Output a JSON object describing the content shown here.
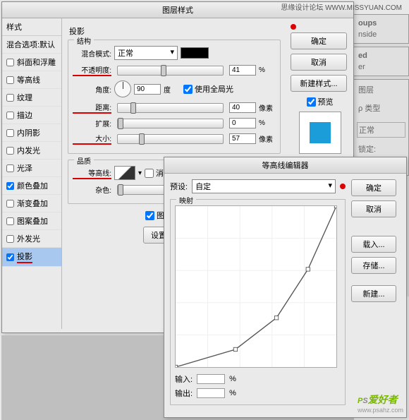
{
  "watermark_top": "思缘设计论坛  WWW.MISSYUAN.COM",
  "watermark_bottom": {
    "p": "P",
    "s": "S",
    "cn": "爱好者",
    "url": "www.psahz.com"
  },
  "bg": {
    "oups": "oups",
    "nside": "nside",
    "ed": "ed",
    "er": "er",
    "layers": "图层",
    "normal": "正常",
    "lock": "锁定:"
  },
  "layer_style": {
    "title": "图层样式",
    "left_header": "样式",
    "blend_default": "混合选项:默认",
    "items": [
      {
        "label": "斜面和浮雕",
        "checked": false
      },
      {
        "label": "等高线",
        "checked": false
      },
      {
        "label": "纹理",
        "checked": false
      },
      {
        "label": "描边",
        "checked": false
      },
      {
        "label": "内阴影",
        "checked": false
      },
      {
        "label": "内发光",
        "checked": false
      },
      {
        "label": "光泽",
        "checked": false
      },
      {
        "label": "颜色叠加",
        "checked": true
      },
      {
        "label": "渐变叠加",
        "checked": false
      },
      {
        "label": "图案叠加",
        "checked": false
      },
      {
        "label": "外发光",
        "checked": false
      },
      {
        "label": "投影",
        "checked": true,
        "selected": true
      }
    ],
    "section": "投影",
    "structure": "结构",
    "blend_mode_label": "混合模式:",
    "blend_mode_value": "正常",
    "opacity_label": "不透明度:",
    "opacity_value": "41",
    "pct": "%",
    "angle_label": "角度:",
    "angle_value": "90",
    "deg": "度",
    "global_light": "使用全局光",
    "distance_label": "距离:",
    "distance_value": "40",
    "px": "像素",
    "spread_label": "扩展:",
    "spread_value": "0",
    "size_label": "大小:",
    "size_value": "57",
    "quality": "品质",
    "contour_label": "等高线:",
    "antialias": "消",
    "noise_label": "杂色:",
    "noise_value": "",
    "knockout": "图层挖空投影",
    "reset_default": "设置为默认值",
    "ok": "确定",
    "cancel": "取消",
    "new_style": "新建样式...",
    "preview": "预览"
  },
  "contour_editor": {
    "title": "等高线编辑器",
    "preset_label": "预设:",
    "preset_value": "自定",
    "mapping": "映射",
    "input_label": "输入:",
    "output_label": "输出:",
    "pct": "%",
    "ok": "确定",
    "cancel": "取消",
    "load": "载入...",
    "save": "存储...",
    "new": "新建..."
  },
  "chart_data": {
    "type": "line",
    "title": "映射",
    "xlabel": "输入",
    "ylabel": "输出",
    "xlim": [
      0,
      255
    ],
    "ylim": [
      0,
      255
    ],
    "points": [
      {
        "x": 0,
        "y": 0
      },
      {
        "x": 95,
        "y": 28
      },
      {
        "x": 160,
        "y": 78
      },
      {
        "x": 210,
        "y": 155
      },
      {
        "x": 255,
        "y": 255
      }
    ]
  }
}
